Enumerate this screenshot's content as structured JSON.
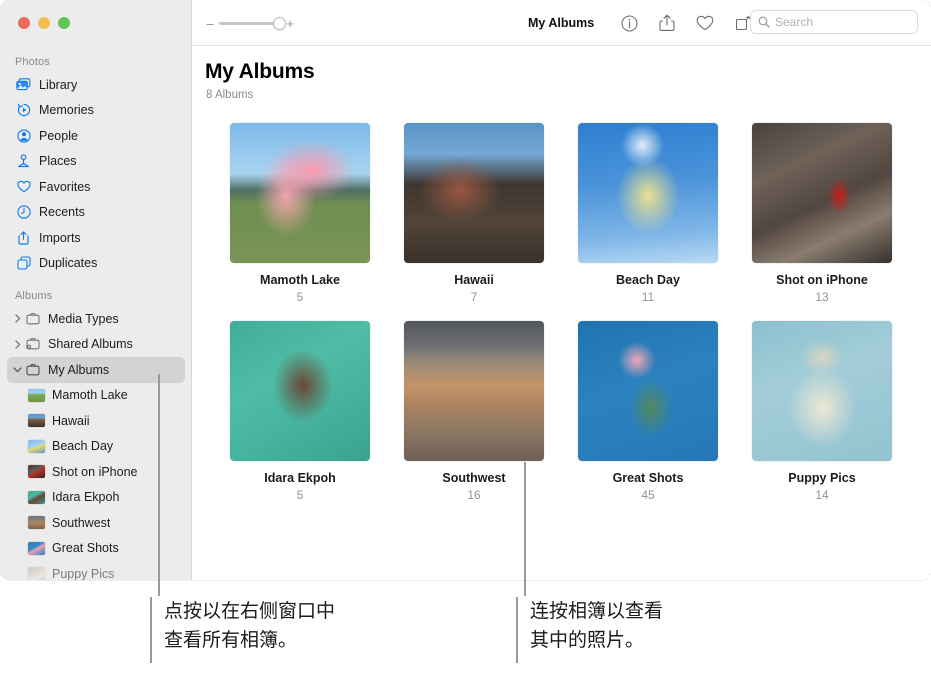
{
  "window": {
    "traffic_lights": [
      "close",
      "minimize",
      "zoom"
    ]
  },
  "sidebar": {
    "sections": [
      {
        "label": "Photos",
        "items": [
          {
            "label": "Library",
            "icon": "library-icon"
          },
          {
            "label": "Memories",
            "icon": "memories-icon"
          },
          {
            "label": "People",
            "icon": "people-icon"
          },
          {
            "label": "Places",
            "icon": "places-icon"
          },
          {
            "label": "Favorites",
            "icon": "heart-icon"
          },
          {
            "label": "Recents",
            "icon": "clock-icon"
          },
          {
            "label": "Imports",
            "icon": "import-icon"
          },
          {
            "label": "Duplicates",
            "icon": "duplicates-icon"
          }
        ]
      },
      {
        "label": "Albums",
        "items": [
          {
            "label": "Media Types",
            "icon": "folder-icon",
            "disclosure": "collapsed"
          },
          {
            "label": "Shared Albums",
            "icon": "shared-folder-icon",
            "disclosure": "collapsed"
          },
          {
            "label": "My Albums",
            "icon": "folder-icon",
            "disclosure": "expanded",
            "selected": true
          }
        ],
        "albums": [
          {
            "label": "Mamoth Lake"
          },
          {
            "label": "Hawaii"
          },
          {
            "label": "Beach Day"
          },
          {
            "label": "Shot on iPhone"
          },
          {
            "label": "Idara Ekpoh"
          },
          {
            "label": "Southwest"
          },
          {
            "label": "Great Shots"
          },
          {
            "label": "Puppy Pics"
          }
        ]
      }
    ]
  },
  "toolbar": {
    "zoom_minus": "–",
    "zoom_plus": "+",
    "zoom_value": 100,
    "title": "My Albums",
    "buttons": [
      {
        "name": "info-button",
        "icon": "info-icon"
      },
      {
        "name": "share-button",
        "icon": "share-icon"
      },
      {
        "name": "favorite-button",
        "icon": "heart-icon"
      },
      {
        "name": "rotate-button",
        "icon": "rotate-icon"
      }
    ],
    "search": {
      "placeholder": "Search",
      "value": "",
      "icon": "search-icon"
    }
  },
  "main": {
    "title": "My Albums",
    "subtitle": "8 Albums",
    "albums": [
      {
        "name": "Mamoth Lake",
        "count": "5"
      },
      {
        "name": "Hawaii",
        "count": "7"
      },
      {
        "name": "Beach Day",
        "count": "11"
      },
      {
        "name": "Shot on iPhone",
        "count": "13"
      },
      {
        "name": "Idara Ekpoh",
        "count": "5"
      },
      {
        "name": "Southwest",
        "count": "16"
      },
      {
        "name": "Great Shots",
        "count": "45"
      },
      {
        "name": "Puppy Pics",
        "count": "14"
      }
    ]
  },
  "callouts": [
    {
      "text": "点按以在右侧窗口中\n查看所有相簿。"
    },
    {
      "text": "连按相簿以查看\n其中的照片。"
    }
  ],
  "colors": {
    "accent": "#0a7cf0",
    "sidebar_bg": "#ececec",
    "selected_bg": "#d3d3d3",
    "secondary_text": "#8a8a8e",
    "leader_line": "#9a9a9e"
  }
}
